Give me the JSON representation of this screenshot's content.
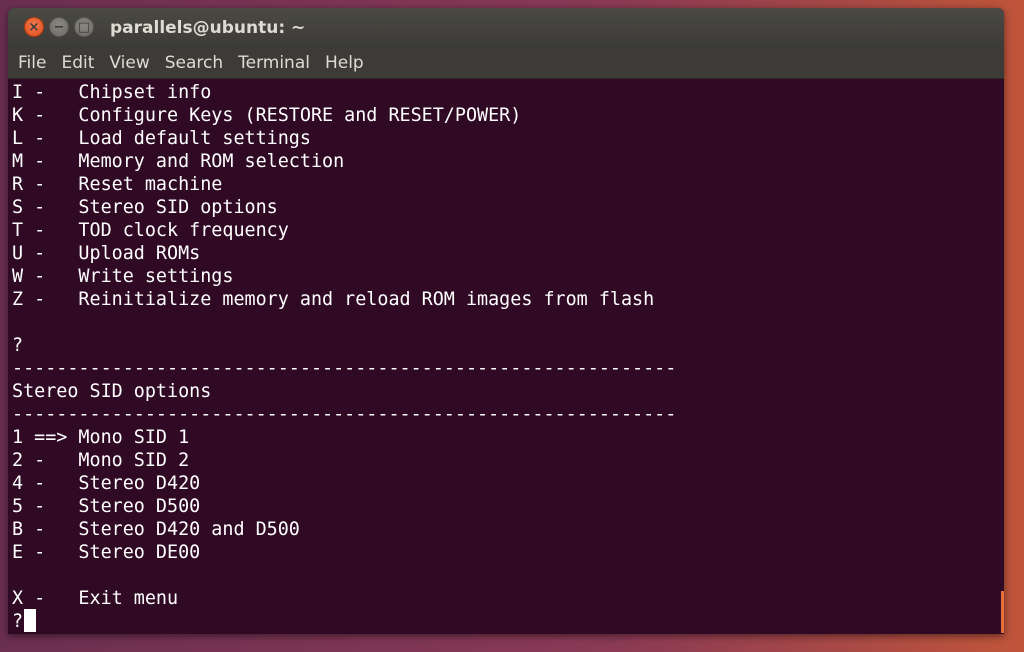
{
  "window": {
    "title": "parallels@ubuntu: ~",
    "close_glyph": "×",
    "min_glyph": "−",
    "max_glyph": "□"
  },
  "menu": [
    "File",
    "Edit",
    "View",
    "Search",
    "Terminal",
    "Help"
  ],
  "terminal_lines": [
    "I -   Chipset info",
    "K -   Configure Keys (RESTORE and RESET/POWER)",
    "L -   Load default settings",
    "M -   Memory and ROM selection",
    "R -   Reset machine",
    "S -   Stereo SID options",
    "T -   TOD clock frequency",
    "U -   Upload ROMs",
    "W -   Write settings",
    "Z -   Reinitialize memory and reload ROM images from flash",
    "",
    "?",
    "------------------------------------------------------------",
    "Stereo SID options",
    "------------------------------------------------------------",
    "1 ==> Mono SID 1",
    "2 -   Mono SID 2",
    "4 -   Stereo D420",
    "5 -   Stereo D500",
    "B -   Stereo D420 and D500",
    "E -   Stereo DE00",
    "",
    "X -   Exit menu",
    "?"
  ],
  "colors": {
    "terminal_bg": "#300a24",
    "terminal_fg": "#ffffff",
    "titlebar_bg": "#3c3b37",
    "close_button": "#e95420"
  }
}
